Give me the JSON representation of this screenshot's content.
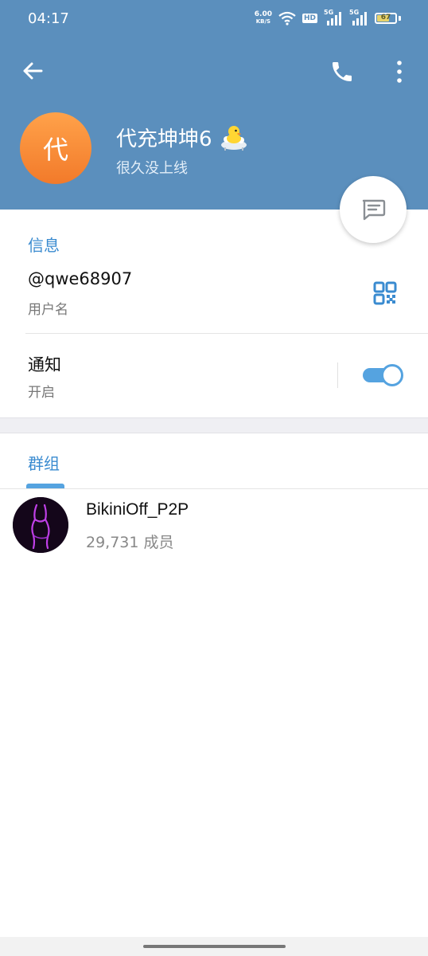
{
  "status_bar": {
    "time": "04:17",
    "net_speed_value": "6.00",
    "net_speed_unit": "KB/S",
    "hd_label": "HD",
    "sim1_label": "5G",
    "sim2_label": "5G",
    "battery_level": "67"
  },
  "profile": {
    "avatar_letter": "代",
    "name": "代充坤坤6",
    "status": "很久没上线"
  },
  "info": {
    "section_title": "信息",
    "username": "@qwe68907",
    "username_label": "用户名",
    "notifications_title": "通知",
    "notifications_value": "开启",
    "notifications_enabled": true
  },
  "groups": {
    "section_title": "群组",
    "items": [
      {
        "name": "BikiniOff_P2P",
        "members": "29,731 成员"
      }
    ]
  },
  "colors": {
    "header": "#5b8fbd",
    "accent": "#3a8bd0",
    "avatar_orange": "#f58c36",
    "toggle": "#55a3e0"
  },
  "icons": {
    "back": "arrow-left-icon",
    "call": "phone-icon",
    "more": "more-vertical-icon",
    "message": "message-icon",
    "qr": "qr-code-icon",
    "emoji": "duck-bath-emoji"
  }
}
